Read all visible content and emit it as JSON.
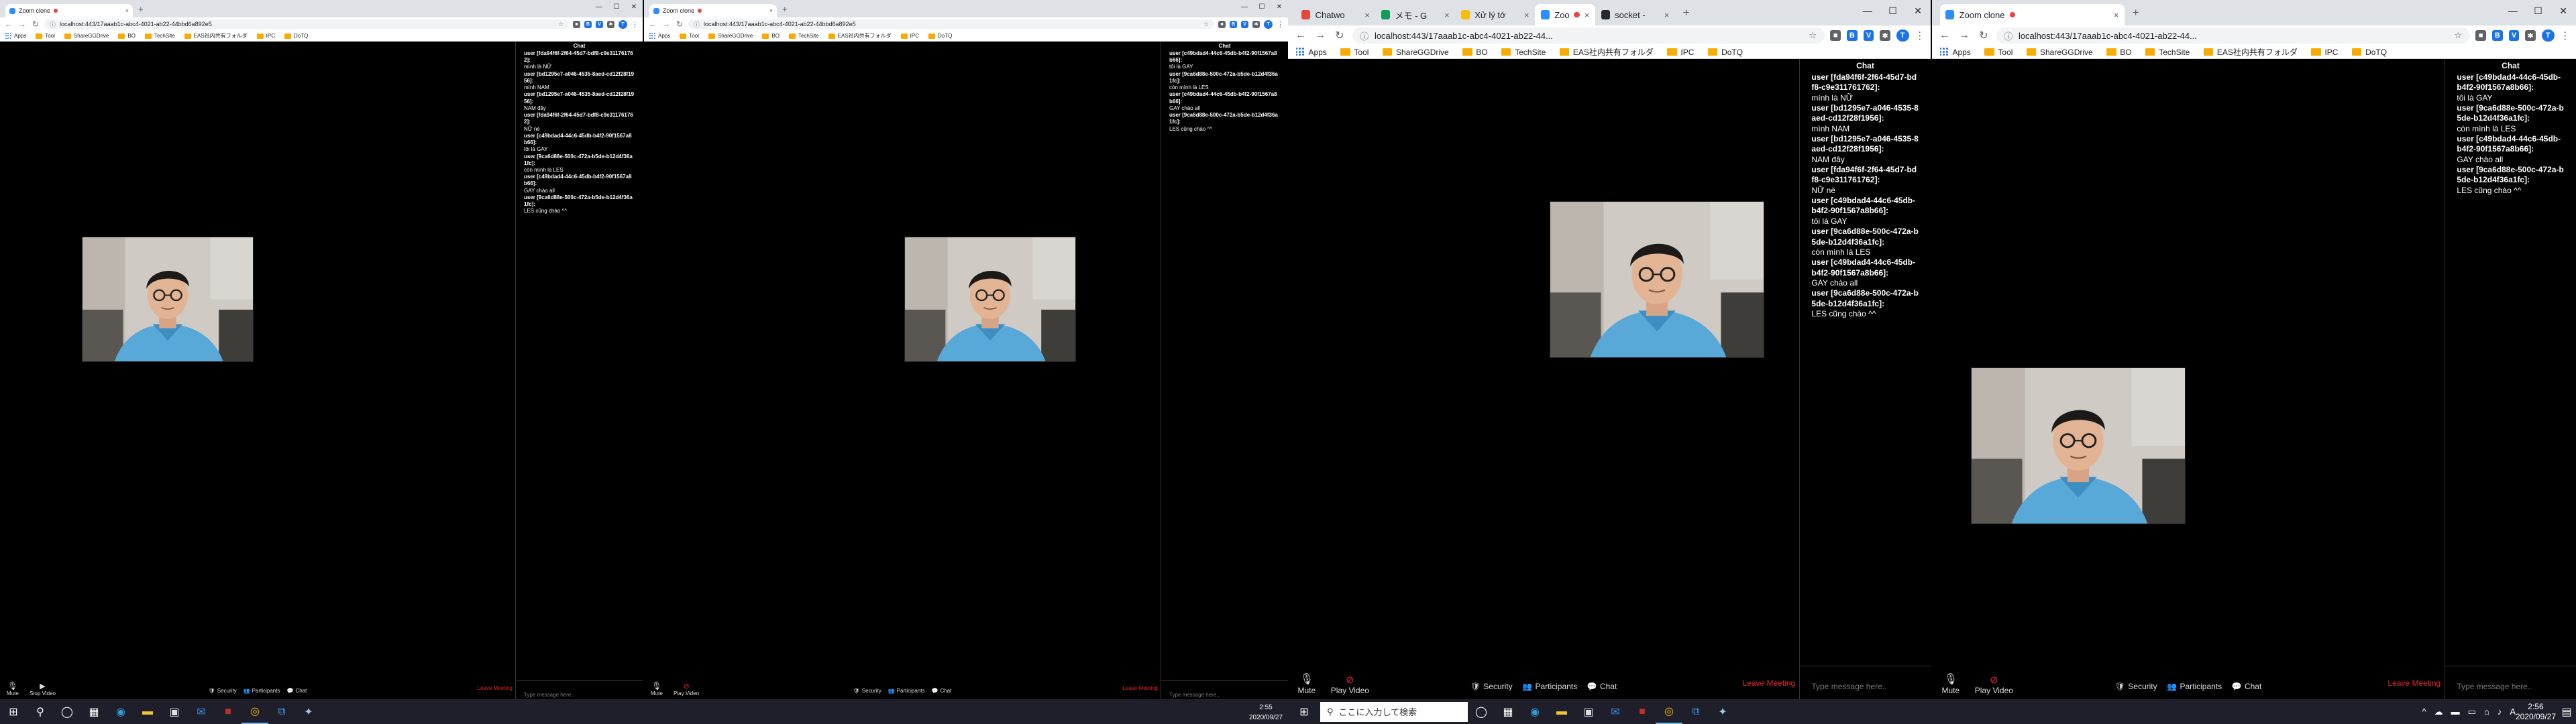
{
  "left_monitor": {
    "windows": [
      {
        "tab_title": "Zoom clone",
        "url": "localhost:443/17aaab1c-abc4-4021-ab22-44bbd6a892e5",
        "bookmarks": [
          "Apps",
          "Tool",
          "ShareGGDrive",
          "BO",
          "TechSite",
          "EAS社内共有フォルダ",
          "IPC",
          "DoTQ"
        ],
        "chat_title": "Chat",
        "messages": [
          {
            "user": "user [fda94f6f-2f64-45d7-bdf8-c9e311761762]:",
            "text": "mình là NỮ"
          },
          {
            "user": "user [bd1295e7-a046-4535-8aed-cd12f28f1956]:",
            "text": "mình NAM"
          },
          {
            "user": "user [bd1295e7-a046-4535-8aed-cd12f28f1956]:",
            "text": "NAM đây"
          },
          {
            "user": "user [fda94f6f-2f64-45d7-bdf8-c9e311761762]:",
            "text": "NỮ nè"
          },
          {
            "user": "user [c49bdad4-44c6-45db-b4f2-90f1567a8b66]:",
            "text": "tôi là GAY"
          },
          {
            "user": "user [9ca6d88e-500c-472a-b5de-b12d4f36a1fc]:",
            "text": "còn mình là LES"
          },
          {
            "user": "user [c49bdad4-44c6-45db-b4f2-90f1567a8b66]:",
            "text": "GAY chào all"
          },
          {
            "user": "user [9ca6d88e-500c-472a-b5de-b12d4f36a1fc]:",
            "text": "LES cũng chào ^^"
          }
        ],
        "chat_placeholder": "Type message here..",
        "mute_label": "Mute",
        "video_label": "Stop Video",
        "security_label": "Security",
        "participants_label": "Participants",
        "chat_label": "Chat",
        "leave_label": "Leave Meeting"
      },
      {
        "tab_title": "Zoom clone",
        "url": "localhost:443/17aaab1c-abc4-4021-ab22-44bbd6a892e5",
        "bookmarks": [
          "Apps",
          "Tool",
          "ShareGGDrive",
          "BO",
          "TechSite",
          "EAS社内共有フォルダ",
          "IPC",
          "DoTQ"
        ],
        "chat_title": "Chat",
        "messages": [
          {
            "user": "user [c49bdad4-44c6-45db-b4f2-90f1567a8b66]:",
            "text": "tôi là GAY"
          },
          {
            "user": "user [9ca6d88e-500c-472a-b5de-b12d4f36a1fc]:",
            "text": "còn mình là LES"
          },
          {
            "user": "user [c49bdad4-44c6-45db-b4f2-90f1567a8b66]:",
            "text": "GAY chào all"
          },
          {
            "user": "user [9ca6d88e-500c-472a-b5de-b12d4f36a1fc]:",
            "text": "LES cũng chào ^^"
          }
        ],
        "chat_placeholder": "Type message here..",
        "mute_label": "Mute",
        "video_label": "Play Video",
        "security_label": "Security",
        "participants_label": "Participants",
        "chat_label": "Chat",
        "leave_label": "Leave Meeting"
      }
    ],
    "clock_time": "2:55",
    "clock_date": "2020/09/27"
  },
  "right_monitor": {
    "windows": [
      {
        "tabs": [
          "Chatwo",
          "メモ - G",
          "Xử lý tớ",
          "Zoo",
          "socket -"
        ],
        "url": "localhost:443/17aaab1c-abc4-4021-ab22-44...",
        "bookmarks": [
          "Apps",
          "Tool",
          "ShareGGDrive",
          "BO",
          "TechSite",
          "EAS社内共有フォルダ",
          "IPC",
          "DoTQ"
        ],
        "chat_title": "Chat",
        "messages": [
          {
            "user": "user [fda94f6f-2f64-45d7-bdf8-c9e311761762]:",
            "text": "mình là NỮ"
          },
          {
            "user": "user [bd1295e7-a046-4535-8aed-cd12f28f1956]:",
            "text": "mình NAM"
          },
          {
            "user": "user [bd1295e7-a046-4535-8aed-cd12f28f1956]:",
            "text": "NAM đây"
          },
          {
            "user": "user [fda94f6f-2f64-45d7-bdf8-c9e311761762]:",
            "text": "NỮ nè"
          },
          {
            "user": "user [c49bdad4-44c6-45db-b4f2-90f1567a8b66]:",
            "text": "tôi là GAY"
          },
          {
            "user": "user [9ca6d88e-500c-472a-b5de-b12d4f36a1fc]:",
            "text": "còn mình là LES"
          },
          {
            "user": "user [c49bdad4-44c6-45db-b4f2-90f1567a8b66]:",
            "text": "GAY chào all"
          },
          {
            "user": "user [9ca6d88e-500c-472a-b5de-b12d4f36a1fc]:",
            "text": "LES cũng chào ^^"
          }
        ],
        "chat_placeholder": "Type message here..",
        "mute_label": "Mute",
        "video_label": "Play Video",
        "security_label": "Security",
        "participants_label": "Participants",
        "chat_label": "Chat",
        "leave_label": "Leave Meeting"
      },
      {
        "tab_title": "Zoom clone",
        "url": "localhost:443/17aaab1c-abc4-4021-ab22-44...",
        "bookmarks": [
          "Apps",
          "Tool",
          "ShareGGDrive",
          "BO",
          "TechSite",
          "EAS社内共有フォルダ",
          "IPC",
          "DoTQ"
        ],
        "chat_title": "Chat",
        "messages": [
          {
            "user": "user [c49bdad4-44c6-45db-b4f2-90f1567a8b66]:",
            "text": "tôi là GAY"
          },
          {
            "user": "user [9ca6d88e-500c-472a-b5de-b12d4f36a1fc]:",
            "text": "còn mình là LES"
          },
          {
            "user": "user [c49bdad4-44c6-45db-b4f2-90f1567a8b66]:",
            "text": "GAY chào all"
          },
          {
            "user": "user [9ca6d88e-500c-472a-b5de-b12d4f36a1fc]:",
            "text": "LES cũng chào ^^"
          }
        ],
        "chat_placeholder": "Type message here..",
        "mute_label": "Mute",
        "video_label": "Play Video",
        "security_label": "Security",
        "participants_label": "Participants",
        "chat_label": "Chat",
        "leave_label": "Leave Meeting"
      }
    ],
    "search_placeholder": "ここに入力して検索",
    "clock_time": "2:56",
    "clock_date": "2020/09/27",
    "ime_label": "A"
  },
  "colors": {
    "leave": "#e02828",
    "taskbar": "#1f1f2b",
    "chrome_tabstrip": "#dee1e6"
  }
}
